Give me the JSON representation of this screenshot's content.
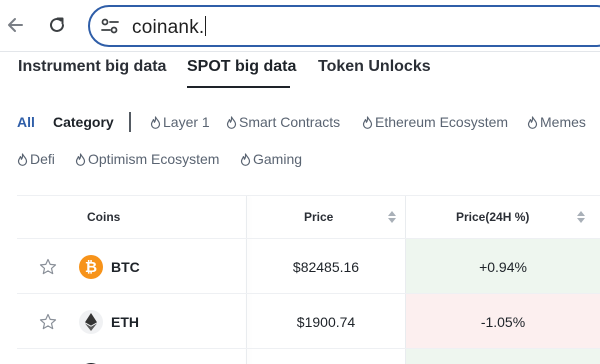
{
  "browser": {
    "url": "coinank."
  },
  "main_tabs": [
    {
      "label": "Instrument big data"
    },
    {
      "label": "SPOT big data"
    },
    {
      "label": "Token Unlocks"
    }
  ],
  "categories": {
    "all": "All",
    "category": "Category",
    "items": [
      {
        "label": "Layer 1"
      },
      {
        "label": "Smart Contracts"
      },
      {
        "label": "Ethereum Ecosystem"
      },
      {
        "label": "Memes"
      },
      {
        "label": "Defi"
      },
      {
        "label": "Optimism Ecosystem"
      },
      {
        "label": "Gaming"
      }
    ]
  },
  "table": {
    "headers": {
      "coins": "Coins",
      "price": "Price",
      "change": "Price(24H %)"
    },
    "rows": [
      {
        "coin": "BTC",
        "icon": "bitcoin-icon",
        "price": "$82485.16",
        "change": "+0.94%",
        "direction": "up"
      },
      {
        "coin": "ETH",
        "icon": "ethereum-icon",
        "price": "$1900.74",
        "change": "-1.05%",
        "direction": "down"
      }
    ]
  },
  "colors": {
    "accent": "#2f5ea8",
    "bitcoin": "#f7931a",
    "positive_bg": "#eef6ef",
    "negative_bg": "#fcefef"
  }
}
